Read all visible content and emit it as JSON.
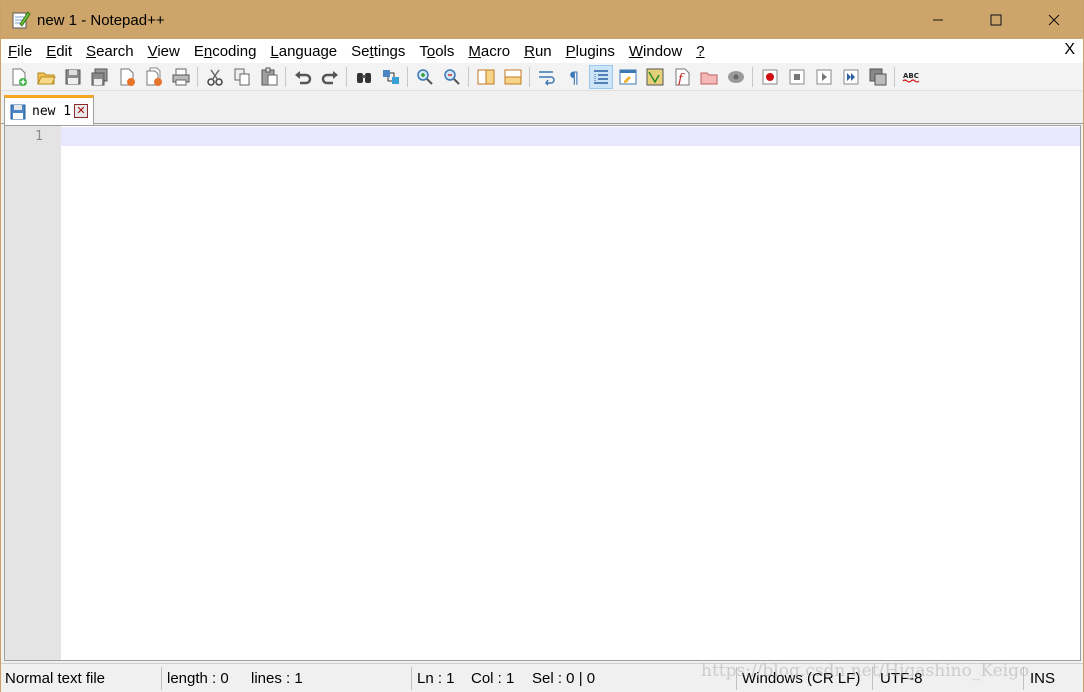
{
  "window": {
    "title": "new 1 - Notepad++"
  },
  "menubar": {
    "items": [
      {
        "pre": "",
        "ul": "F",
        "post": "ile"
      },
      {
        "pre": "",
        "ul": "E",
        "post": "dit"
      },
      {
        "pre": "",
        "ul": "S",
        "post": "earch"
      },
      {
        "pre": "",
        "ul": "V",
        "post": "iew"
      },
      {
        "pre": "E",
        "ul": "n",
        "post": "coding"
      },
      {
        "pre": "",
        "ul": "L",
        "post": "anguage"
      },
      {
        "pre": "Se",
        "ul": "t",
        "post": "tings"
      },
      {
        "pre": "T",
        "ul": "o",
        "post": "ols"
      },
      {
        "pre": "",
        "ul": "M",
        "post": "acro"
      },
      {
        "pre": "",
        "ul": "R",
        "post": "un"
      },
      {
        "pre": "",
        "ul": "P",
        "post": "lugins"
      },
      {
        "pre": "",
        "ul": "W",
        "post": "indow"
      },
      {
        "pre": "",
        "ul": "?",
        "post": ""
      }
    ],
    "close_label": "X"
  },
  "tabs": [
    {
      "label": "new 1",
      "close": "✕"
    }
  ],
  "editor": {
    "line_numbers": [
      "1"
    ]
  },
  "statusbar": {
    "file_type": "Normal text file",
    "length": "length : 0",
    "lines": "lines : 1",
    "ln": "Ln : 1",
    "col": "Col : 1",
    "sel": "Sel : 0 | 0",
    "eol": "Windows (CR LF)",
    "encoding": "UTF-8",
    "mode": "INS"
  },
  "watermark": "https://blog.csdn.net/Higashino_Keigo",
  "colors": {
    "titlebar": "#cda56a",
    "tab_accent": "#f5a623",
    "current_line": "#e8e8ff"
  }
}
